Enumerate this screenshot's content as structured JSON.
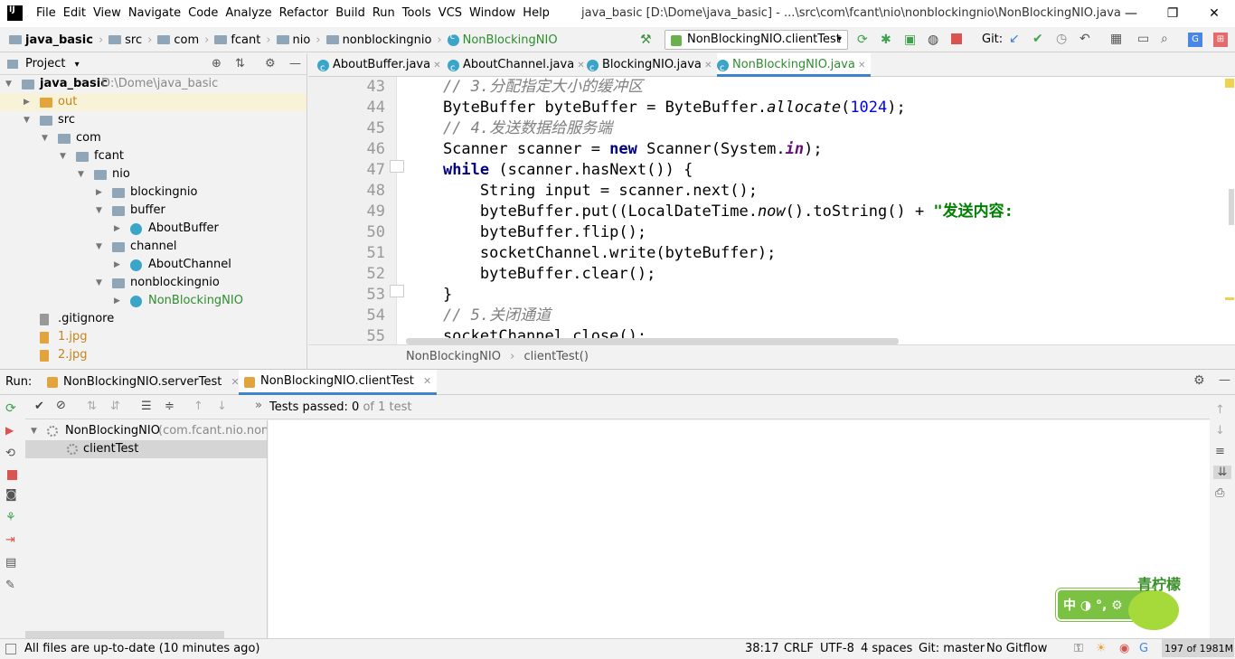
{
  "menu": [
    "File",
    "Edit",
    "View",
    "Navigate",
    "Code",
    "Analyze",
    "Refactor",
    "Build",
    "Run",
    "Tools",
    "VCS",
    "Window",
    "Help"
  ],
  "window_title": "java_basic [D:\\Dome\\java_basic] - ...\\src\\com\\fcant\\nio\\nonblockingnio\\NonBlockingNIO.java",
  "breadcrumb": [
    "java_basic",
    "src",
    "com",
    "fcant",
    "nio",
    "nonblockingnio",
    "NonBlockingNIO"
  ],
  "run_config": "NonBlockingNIO.clientTest",
  "git_label": "Git:",
  "project_panel": {
    "title": "Project",
    "tree": [
      {
        "label": "java_basic",
        "note": "D:\\Dome\\java_basic",
        "depth": 0,
        "arrow": "down",
        "icon": "folder-icon"
      },
      {
        "label": "out",
        "depth": 1,
        "arrow": "right",
        "icon": "folder-icon",
        "color": "#c7841b"
      },
      {
        "label": "src",
        "depth": 1,
        "arrow": "down",
        "icon": "folder-icon"
      },
      {
        "label": "com",
        "depth": 2,
        "arrow": "down",
        "icon": "folder-icon"
      },
      {
        "label": "fcant",
        "depth": 3,
        "arrow": "down",
        "icon": "folder-icon"
      },
      {
        "label": "nio",
        "depth": 4,
        "arrow": "down",
        "icon": "folder-icon"
      },
      {
        "label": "blockingnio",
        "depth": 5,
        "arrow": "right",
        "icon": "folder-icon"
      },
      {
        "label": "buffer",
        "depth": 5,
        "arrow": "down",
        "icon": "folder-icon"
      },
      {
        "label": "AboutBuffer",
        "depth": 6,
        "arrow": "right",
        "icon": "class-icon"
      },
      {
        "label": "channel",
        "depth": 5,
        "arrow": "down",
        "icon": "folder-icon"
      },
      {
        "label": "AboutChannel",
        "depth": 6,
        "arrow": "right",
        "icon": "class-icon"
      },
      {
        "label": "nonblockingnio",
        "depth": 5,
        "arrow": "down",
        "icon": "folder-icon"
      },
      {
        "label": "NonBlockingNIO",
        "depth": 6,
        "arrow": "right",
        "icon": "class-icon",
        "color": "#2f8c2f"
      },
      {
        "label": ".gitignore",
        "depth": 1,
        "arrow": "",
        "icon": "file-icon"
      },
      {
        "label": "1.jpg",
        "depth": 1,
        "arrow": "",
        "icon": "image-icon",
        "color": "#c7841b"
      },
      {
        "label": "2.jpg",
        "depth": 1,
        "arrow": "",
        "icon": "image-icon",
        "color": "#c7841b"
      }
    ]
  },
  "editor_tabs": [
    "AboutBuffer.java",
    "AboutChannel.java",
    "BlockingNIO.java",
    "NonBlockingNIO.java"
  ],
  "active_tab": "NonBlockingNIO.java",
  "line_numbers": [
    "43",
    "44",
    "45",
    "46",
    "47",
    "48",
    "49",
    "50",
    "51",
    "52",
    "53",
    "54",
    "55"
  ],
  "code_lines": [
    "// 3.分配指定大小的缓冲区",
    "ByteBuffer byteBuffer = ByteBuffer.allocate(1024);",
    "// 4.发送数据给服务端",
    "Scanner scanner = new Scanner(System.in);",
    "while (scanner.hasNext()) {",
    "    String input = scanner.next();",
    "    byteBuffer.put((LocalDateTime.now().toString() + \"发送内容:",
    "    byteBuffer.flip();",
    "    socketChannel.write(byteBuffer);",
    "    byteBuffer.clear();",
    "}",
    "// 5.关闭通道",
    "socketChannel.close();"
  ],
  "editor_breadcrumb": [
    "NonBlockingNIO",
    "clientTest()"
  ],
  "run_panel": {
    "label": "Run:",
    "tabs": [
      "NonBlockingNIO.serverTest",
      "NonBlockingNIO.clientTest"
    ],
    "tests_passed_label": "Tests passed:",
    "tests_passed_value": "0",
    "tests_total": "of 1 test",
    "test_root": "NonBlockingNIO",
    "test_root_pkg": "(com.fcant.nio.nonblo",
    "test_child": "clientTest"
  },
  "statusbar": {
    "message": "All files are up-to-date (10 minutes ago)",
    "position": "38:17",
    "line_sep": "CRLF",
    "encoding": "UTF-8",
    "indent": "4 spaces",
    "branch": "Git: master",
    "gitflow": "No Gitflow",
    "memory": "197 of 1981M"
  },
  "watermark": "青柠檬"
}
